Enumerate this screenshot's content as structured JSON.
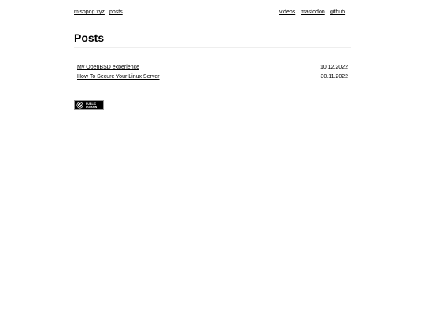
{
  "nav": {
    "site": "misopog.xyz",
    "posts": "posts",
    "videos": "videos",
    "mastodon": "mastodon",
    "github": "github"
  },
  "page_title": "Posts",
  "posts": [
    {
      "title": "My OpenBSD experience",
      "date": "10.12.2022"
    },
    {
      "title": "How To Secure Your Linux Server",
      "date": "30.11.2022"
    }
  ],
  "footer": {
    "license_badge": {
      "icon": "public-domain-icon",
      "line1": "PUBLIC",
      "line2": "DOMAIN"
    }
  }
}
